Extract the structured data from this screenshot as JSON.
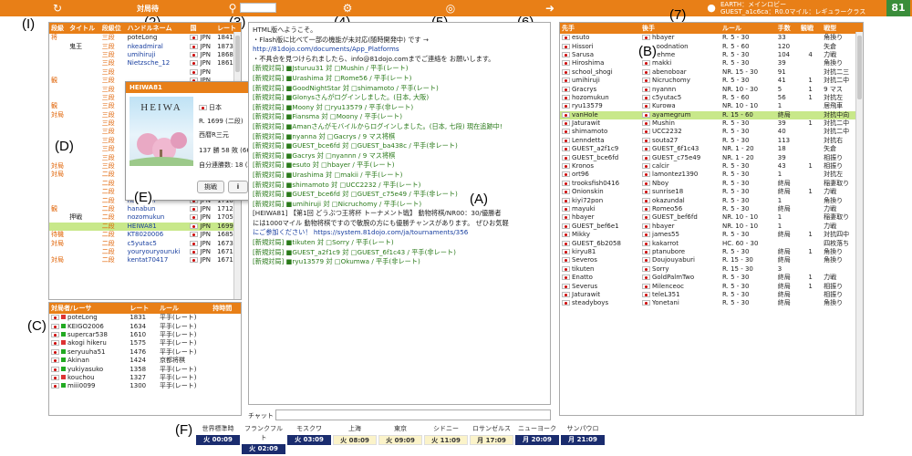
{
  "topbar": {
    "reload_icon": "refresh-icon",
    "menu_label": "対局待",
    "settings_icon": "gear-icon",
    "globe_icon": "globe-icon",
    "logout_icon": "logout-icon",
    "lobby_line1": "EARTH：メインロビー",
    "lobby_line2": "GUEST_a1c6ca：R0.0マイル：レギュラークラス",
    "logo": "81"
  },
  "labels": {
    "I": "(I)",
    "two": "(2)",
    "three": "(3)",
    "four": "(4)",
    "five": "(5)",
    "six": "(6)",
    "seven": "(7)",
    "A": "(A)",
    "B": "(B)",
    "C": "(C)",
    "D": "(D)",
    "E": "(E)",
    "F": "(F)"
  },
  "players": {
    "headers": [
      "段級",
      "タイトル",
      "段級位",
      "ハンドルネーム",
      "国",
      "レート"
    ],
    "rows": [
      [
        "将",
        "",
        "三段",
        "poteLong",
        "JPN",
        "1841"
      ],
      [
        "",
        "鬼王",
        "三段",
        "nkeadmiral",
        "JPN",
        "1873"
      ],
      [
        "",
        "",
        "三段",
        "umihiruji",
        "JPN",
        "1868"
      ],
      [
        "",
        "",
        "三段",
        "Nietzsche_12",
        "JPN",
        "1861"
      ],
      [
        "",
        "",
        "三段",
        "",
        "JPN",
        ""
      ],
      [
        "観",
        "",
        "三段",
        "",
        "JPN",
        ""
      ],
      [
        "",
        "",
        "三段",
        "",
        "JPN",
        ""
      ],
      [
        "",
        "",
        "三段",
        "",
        "JPN",
        ""
      ],
      [
        "観",
        "",
        "三段",
        "",
        "JPN",
        ""
      ],
      [
        "対局",
        "",
        "三段",
        "",
        "JPN",
        ""
      ],
      [
        "",
        "",
        "三段",
        "",
        "JPN",
        ""
      ],
      [
        "",
        "",
        "三段",
        "",
        "JPN",
        ""
      ],
      [
        "",
        "",
        "三段",
        "",
        "JPN",
        ""
      ],
      [
        "",
        "",
        "三段",
        "",
        "JPN",
        ""
      ],
      [
        "",
        "",
        "三段",
        "",
        "JPN",
        ""
      ],
      [
        "対局",
        "",
        "三段",
        "",
        "JPN",
        ""
      ],
      [
        "対局",
        "",
        "二段",
        "",
        "JPN",
        ""
      ],
      [
        "",
        "",
        "二段",
        "",
        "JPN",
        ""
      ],
      [
        "",
        "",
        "二段",
        "WhtMind",
        "JPN",
        "1712"
      ],
      [
        "",
        "",
        "二段",
        "hanabun",
        "JPN",
        "1710"
      ],
      [
        "観",
        "",
        "二段",
        "hanabun",
        "JPN",
        "1712"
      ],
      [
        "",
        "押戦",
        "二段",
        "nozomukun",
        "JPN",
        "1705"
      ],
      [
        "",
        "",
        "二段",
        "HEIWA81",
        "JPN",
        "1699"
      ],
      [
        "待機",
        "",
        "二段",
        "KT8020006",
        "JPN",
        "1685"
      ],
      [
        "対局",
        "",
        "二段",
        "c5yutac5",
        "JPN",
        "1673"
      ],
      [
        "",
        "",
        "二段",
        "youryouryouruki",
        "JPN",
        "1671"
      ],
      [
        "対局",
        "",
        "二段",
        "kentat70417",
        "JPN",
        "1671"
      ]
    ],
    "highlight_row": 22
  },
  "challenges": {
    "headers": [
      "対局者/レーサ",
      "レート",
      "ルール",
      "持時間"
    ],
    "rows": [
      [
        "poteLong",
        "1831",
        "平手(レート)",
        ""
      ],
      [
        "KEIGO2006",
        "1634",
        "平手(レート)",
        ""
      ],
      [
        "supercar538",
        "1610",
        "平手(レート)",
        ""
      ],
      [
        "akogi hikeru",
        "1575",
        "平手(レート)",
        ""
      ],
      [
        "seryuuha51",
        "1476",
        "平手(レート)",
        ""
      ],
      [
        "Akinan",
        "1424",
        "京都将棋",
        ""
      ],
      [
        "yukiyasuko",
        "1358",
        "平手(レート)",
        ""
      ],
      [
        "kouchou",
        "1327",
        "平手(レート)",
        ""
      ],
      [
        "miii0099",
        "1300",
        "平手(レート)",
        ""
      ]
    ]
  },
  "popup": {
    "title": "HEIWA81",
    "avatar_text": "HEIWA",
    "country": "日本",
    "rate": "R. 1699 (二段)",
    "region": "西暦R三元",
    "record": "137 勝 58 敗 (66.9%)",
    "streak": "自分連勝数: 18 (現在: 0)",
    "btn_challenge": "挑戦",
    "btn_info": "i",
    "btn_chat": "💬"
  },
  "chat": {
    "lines": [
      "HTML版へようこそ。",
      "・Flash版に比べて一部の機能が未対応(随時開発中) です →",
      "http://81dojo.com/documents/App_Platforms",
      "・不具合を見つけられましたら、info@81dojo.comまでご連絡を お願いします。",
      "[新規対局] ■Jsturuu31 対 □Mushin / 平手(レート)",
      "[新規対局] ■Urashima 対 □Rome56 / 平手(レート)",
      "[新規対局] ■GoodNightStar 対 □shimamoto / 平手(レート)",
      "[新規対局] ■Glonysさんがログインしました。(日本, 大阪)",
      "[新規対局] ■Moony 対 □ryu13579 / 平手(非レート)",
      "[新規対局] ■Fiansma 対 □Moony / 平手(レート)",
      "[新規対局] ■Amanさんがモバイルからログインしました。(日本, 七段) 現在追跡中!",
      "[新規対局] ■nyanna 対 □Gacrys / 9 マス将棋",
      "[新規対局] ■GUEST_bce6fd 対 □GUEST_ba438c / 平手(非レート)",
      "[新規対局] ■Gacrys 対 □nyannn / 9 マス将棋",
      "[新規対局] ■esuto 対 □hbayer / 平手(レート)",
      "[新規対局] ■Urashima 対 □makii / 平手(レート)",
      "[新規対局] ■shimamoto 対 □UCC2232 / 平手(レート)",
      "[新規対局] ■GUEST_bce6fd 対 □GUEST_c75e49 / 平手(非レート)",
      "[新規対局] ■umihiruji 対 □Nicruchomy / 平手(レート)",
      "[HEIWA81] 【第1回 どうぶつ王将杯 トーナメント戦】 動物将棋/NR00：30/優勝者",
      "には1000マイル 動物将棋ですので敏腕の方にも優勝チャンスがあります。 ぜひお気軽",
      "にご参加ください！ https://system.81dojo.com/ja/tournaments/356",
      "[新規対局] ■tikuten 対 □Sorry / 平手(レート)",
      "[新規対局] ■GUEST_a2f1c9 対 □GUEST_6f1c43 / 平手(非レート)",
      "[新規対局] ■ryu13579 対 □Okumwa / 平手(非レート)"
    ],
    "input_label": "チャット"
  },
  "games": {
    "headers": [
      "先手",
      "後手",
      "ルール",
      "手数",
      "観戦",
      "戦型"
    ],
    "rows": [
      [
        "esuto",
        "hbayer",
        "R. 5 - 30",
        "33",
        "",
        "角換り"
      ],
      [
        "Hissori",
        "goodnation",
        "R. 5 - 60",
        "120",
        "",
        "矢倉"
      ],
      [
        "Sarusa",
        "Hehme",
        "R. 5 - 30",
        "104",
        "4",
        "力戦"
      ],
      [
        "Hiroshima",
        "makki",
        "R. 5 - 30",
        "39",
        "",
        "角換り"
      ],
      [
        "school_shogi",
        "abenoboar",
        "NR. 15 - 30",
        "91",
        "",
        "対抗二三"
      ],
      [
        "umihiruji",
        "Nicruchomy",
        "R. 5 - 30",
        "41",
        "1",
        "対抗二中"
      ],
      [
        "Gracrys",
        "nyannn",
        "NR. 10 - 30",
        "5",
        "1",
        "9 マス"
      ],
      [
        "hozomukun",
        "c5yutac5",
        "R. 5 - 60",
        "56",
        "1",
        "対抗左"
      ],
      [
        "ryu13579",
        "Kurowa",
        "NR. 10 - 10",
        "1",
        "",
        "居飛車"
      ],
      [
        "vanHole",
        "ayamegrum",
        "R. 15 - 60",
        "終局",
        "",
        "対抗中向"
      ],
      [
        "Jaturawit",
        "Mushin",
        "R. 5 - 30",
        "39",
        "1",
        "対抗二中"
      ],
      [
        "shimamoto",
        "UCC2232",
        "R. 5 - 30",
        "40",
        "",
        "対抗二中"
      ],
      [
        "Lenndetta",
        "souta27",
        "R. 5 - 30",
        "113",
        "",
        "対抗右"
      ],
      [
        "GUEST_a2f1c9",
        "GUEST_6f1c43",
        "NR. 1 - 20",
        "18",
        "",
        "矢倉"
      ],
      [
        "GUEST_bce6fd",
        "GUEST_c75e49",
        "NR. 1 - 20",
        "39",
        "",
        "相振り"
      ],
      [
        "Kronos",
        "calcir",
        "R. 5 - 30",
        "43",
        "1",
        "相振り"
      ],
      [
        "ort96",
        "lamontez1390",
        "R. 5 - 30",
        "1",
        "",
        "対抗左"
      ],
      [
        "trooksfish0416",
        "Nboy",
        "R. 5 - 30",
        "終局",
        "",
        "稲妻取り"
      ],
      [
        "Onionskin",
        "sunrise18",
        "R. 5 - 30",
        "終局",
        "1",
        "力戦"
      ],
      [
        "kiyi72pon",
        "okazundal",
        "R. 5 - 30",
        "1",
        "",
        "角換り"
      ],
      [
        "mayuki",
        "Romeo56",
        "R. 5 - 30",
        "終局",
        "",
        "力戦"
      ],
      [
        "hbayer",
        "GUEST_bef6fd",
        "NR. 10 - 10",
        "1",
        "",
        "稲妻取り"
      ],
      [
        "GUEST_bef6e1",
        "hbayer",
        "NR. 10 - 10",
        "1",
        "",
        "力戦"
      ],
      [
        "Mikky",
        "james55",
        "R. 5 - 30",
        "終局",
        "1",
        "対抗四中"
      ],
      [
        "GUEST_6b2058",
        "kakarrot",
        "HC. 60 - 30",
        "",
        "",
        "四枚落ち"
      ],
      [
        "kiryu81",
        "ptanubore",
        "R. 5 - 30",
        "終局",
        "1",
        "角換り"
      ],
      [
        "Severos",
        "Doujouyaburi",
        "R. 15 - 30",
        "終局",
        "",
        "角換り"
      ],
      [
        "tikuten",
        "Sorry",
        "R. 15 - 30",
        "3",
        "",
        ""
      ],
      [
        "Enatto",
        "GoldPalmTwo",
        "R. 5 - 30",
        "終局",
        "1",
        "力戦"
      ],
      [
        "Severus",
        "Milenceoc",
        "R. 5 - 30",
        "終局",
        "1",
        "相振り"
      ],
      [
        "Jaturawit",
        "teleL351",
        "R. 5 - 30",
        "終局",
        "",
        "相振り"
      ],
      [
        "steadyboys",
        "Yonetani",
        "R. 5 - 30",
        "終局",
        "",
        "角換り"
      ]
    ],
    "highlight_row": 9
  },
  "clocks": [
    {
      "city": "世界標準時",
      "time": "火 00:09",
      "style": "dark"
    },
    {
      "city": "フランクフルト",
      "time": "火 02:09",
      "style": "dark"
    },
    {
      "city": "モスクワ",
      "time": "火 03:09",
      "style": "dark"
    },
    {
      "city": "上海",
      "time": "火 08:09",
      "style": "light"
    },
    {
      "city": "東京",
      "time": "火 09:09",
      "style": "light"
    },
    {
      "city": "シドニー",
      "time": "火 11:09",
      "style": "light"
    },
    {
      "city": "ロサンゼルス",
      "time": "月 17:09",
      "style": "light"
    },
    {
      "city": "ニューヨーク",
      "time": "月 20:09",
      "style": "dark"
    },
    {
      "city": "サンパウロ",
      "time": "月 21:09",
      "style": "dark"
    }
  ],
  "colors": {
    "accent": "#e87f17",
    "highlight": "#c8e88a",
    "clock_dark": "#1a2c6e"
  }
}
